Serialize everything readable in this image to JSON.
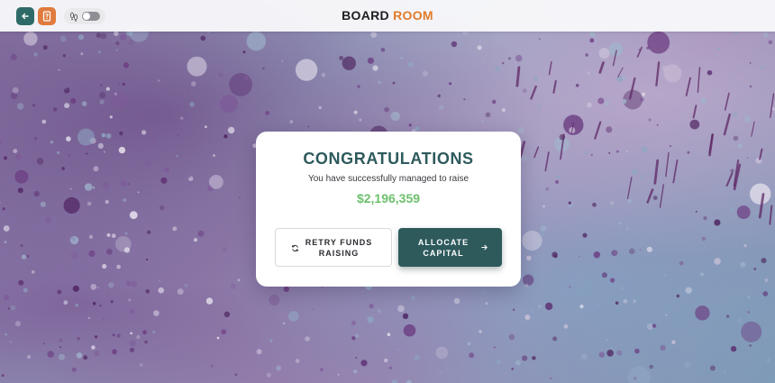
{
  "header": {
    "logo_part1": "BOARD",
    "logo_part2": "ROOM",
    "back_icon": "arrow-left-icon",
    "doc_icon": "document-icon",
    "toggle_icon": "footsteps-icon",
    "toggle_state": "off"
  },
  "dialog": {
    "title": "CONGRATULATIONS",
    "subtitle": "You have successfully managed to raise",
    "amount": "$2,196,359",
    "retry_label": "RETRY FUNDS\nRAISING",
    "retry_icon": "refresh-icon",
    "allocate_label": "ALLOCATE\nCAPITAL",
    "allocate_icon": "arrow-right-icon"
  },
  "colors": {
    "primary": "#2e5a5c",
    "accent": "#e07b2a",
    "amount": "#6cc06c"
  }
}
